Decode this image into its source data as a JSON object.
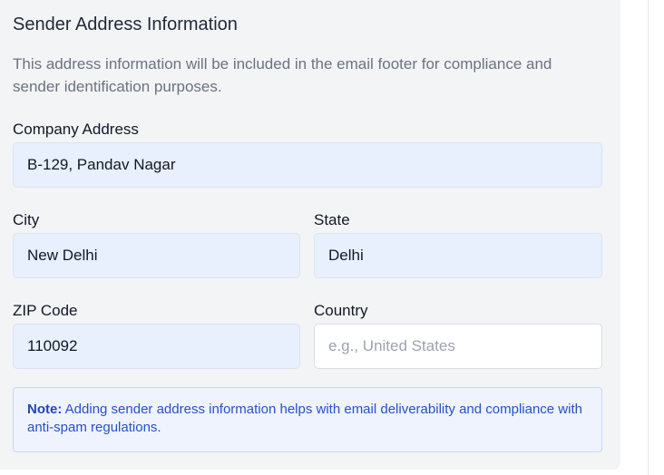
{
  "section": {
    "title": "Sender Address Information",
    "description": "This address information will be included in the email footer for compliance and sender identification purposes."
  },
  "fields": {
    "company_address": {
      "label": "Company Address",
      "value": "B-129, Pandav Nagar",
      "placeholder": ""
    },
    "city": {
      "label": "City",
      "value": "New Delhi",
      "placeholder": ""
    },
    "state": {
      "label": "State",
      "value": "Delhi",
      "placeholder": ""
    },
    "zip": {
      "label": "ZIP Code",
      "value": "110092",
      "placeholder": ""
    },
    "country": {
      "label": "Country",
      "value": "",
      "placeholder": "e.g., United States"
    }
  },
  "note": {
    "prefix": "Note:",
    "text": "Adding sender address information helps with email deliverability and compliance with anti-spam regulations."
  },
  "colors": {
    "panel_background": "#f3f4f6",
    "filled_input_background": "#e8effd",
    "note_text": "#2850c8",
    "note_background": "#eef3fe"
  }
}
